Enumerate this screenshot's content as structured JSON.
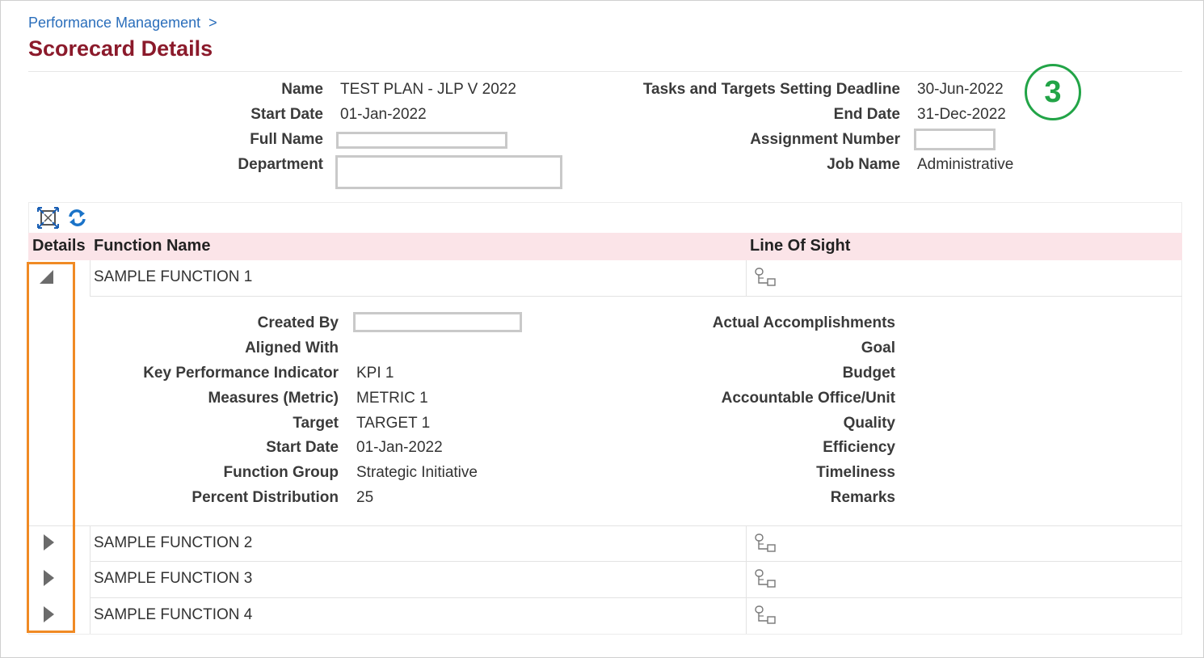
{
  "breadcrumb": {
    "link": "Performance Management",
    "separator": ">"
  },
  "page_title": "Scorecard Details",
  "step_badge": "3",
  "header_fields": {
    "name_label": "Name",
    "name_value": "TEST PLAN - JLP V 2022",
    "start_date_label": "Start Date",
    "start_date_value": "01-Jan-2022",
    "full_name_label": "Full Name",
    "department_label": "Department",
    "deadline_label": "Tasks and Targets Setting Deadline",
    "deadline_value": "30-Jun-2022",
    "end_date_label": "End Date",
    "end_date_value": "31-Dec-2022",
    "assignment_label": "Assignment Number",
    "job_name_label": "Job Name",
    "job_name_value": "Administrative"
  },
  "toolbar": {
    "icons": [
      "expand-all-icon",
      "refresh-icon"
    ]
  },
  "table": {
    "headers": {
      "details": "Details",
      "function_name": "Function Name",
      "line_of_sight": "Line Of Sight"
    },
    "rows": [
      {
        "function_name": "SAMPLE FUNCTION 1",
        "expanded": true
      },
      {
        "function_name": "SAMPLE FUNCTION 2",
        "expanded": false
      },
      {
        "function_name": "SAMPLE FUNCTION 3",
        "expanded": false
      },
      {
        "function_name": "SAMPLE FUNCTION 4",
        "expanded": false
      }
    ]
  },
  "detail": {
    "created_by_label": "Created By",
    "aligned_with_label": "Aligned With",
    "kpi_label": "Key Performance Indicator",
    "kpi_value": "KPI 1",
    "measures_label": "Measures (Metric)",
    "measures_value": "METRIC 1",
    "target_label": "Target",
    "target_value": "TARGET 1",
    "start_date_label": "Start Date",
    "start_date_value": "01-Jan-2022",
    "function_group_label": "Function Group",
    "function_group_value": "Strategic Initiative",
    "percent_label": "Percent Distribution",
    "percent_value": "25",
    "actual_label": "Actual Accomplishments",
    "goal_label": "Goal",
    "budget_label": "Budget",
    "office_label": "Accountable Office/Unit",
    "quality_label": "Quality",
    "efficiency_label": "Efficiency",
    "timeliness_label": "Timeliness",
    "remarks_label": "Remarks"
  },
  "colors": {
    "title": "#8b1a2b",
    "link": "#2a6ebb",
    "header_bg": "#fbe4e8",
    "highlight": "#f08a24",
    "badge": "#22a447"
  }
}
